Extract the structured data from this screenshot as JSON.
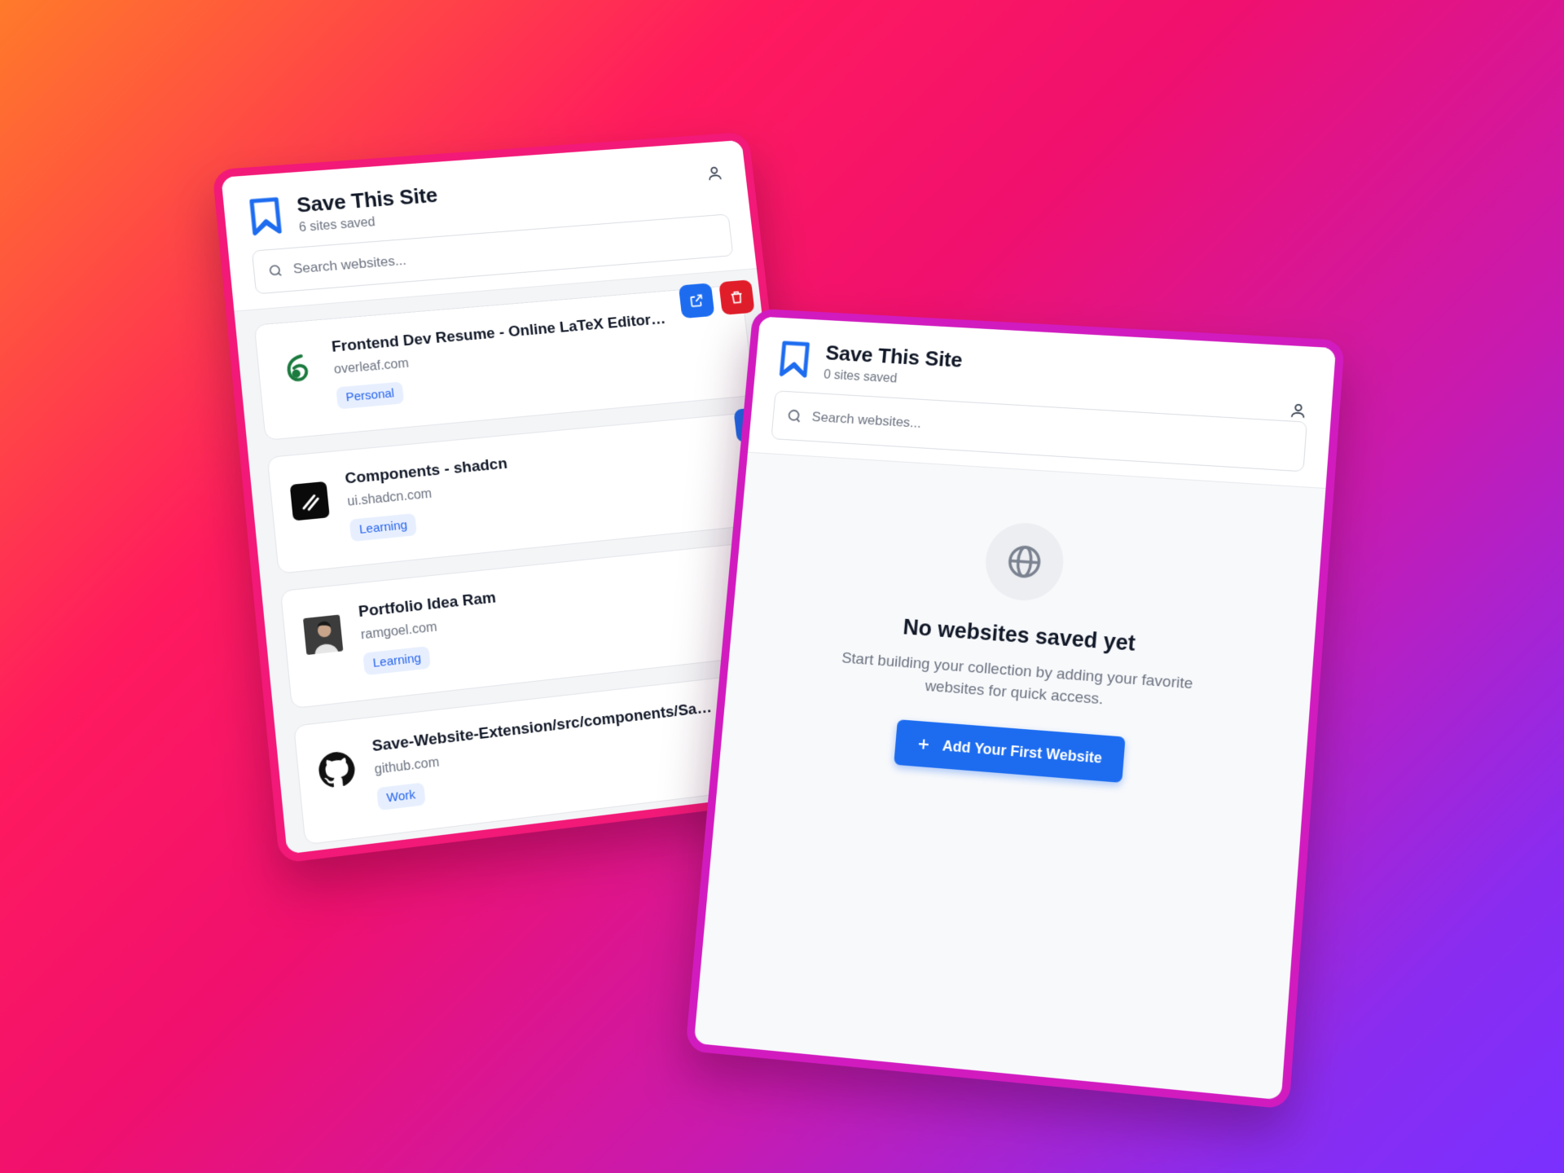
{
  "popups": {
    "left": {
      "title": "Save This Site",
      "subtitle": "6 sites saved",
      "search_placeholder": "Search websites...",
      "sites": [
        {
          "title": "Frontend Dev Resume - Online LaTeX Editor Ov...",
          "domain": "overleaf.com",
          "tag": "Personal",
          "icon": "overleaf-icon"
        },
        {
          "title": "Components - shadcn",
          "domain": "ui.shadcn.com",
          "tag": "Learning",
          "icon": "shadcn-icon"
        },
        {
          "title": "Portfolio Idea Ram",
          "domain": "ramgoel.com",
          "tag": "Learning",
          "icon": "avatar-icon"
        },
        {
          "title": "Save-Website-Extension/src/components/Save...",
          "domain": "github.com",
          "tag": "Work",
          "icon": "github-icon"
        }
      ]
    },
    "right": {
      "title": "Save This Site",
      "subtitle": "0 sites saved",
      "search_placeholder": "Search websites...",
      "empty_title": "No websites saved yet",
      "empty_desc": "Start building your collection by adding your favorite websites for quick access.",
      "add_button": "Add Your First Website"
    }
  },
  "colors": {
    "accent": "#1d6cf0",
    "danger": "#e11d2a",
    "tag_bg": "#e7efff",
    "tag_text": "#2563eb"
  }
}
